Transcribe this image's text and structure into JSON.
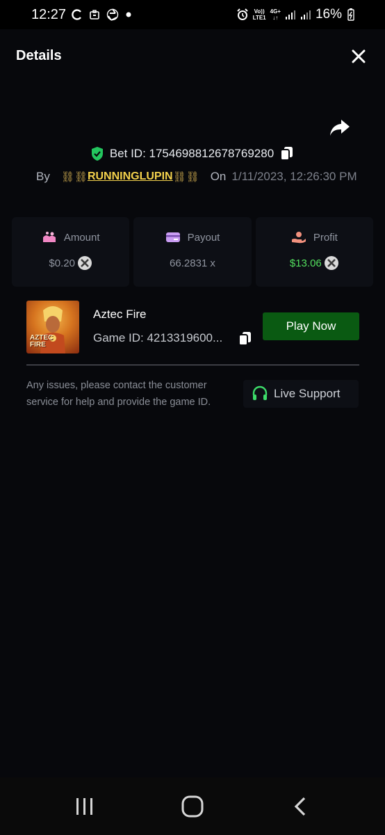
{
  "status_bar": {
    "time": "12:27",
    "battery": "16%",
    "network": "4G+",
    "volte": "Vo))",
    "lte": "LTE1"
  },
  "header": {
    "title": "Details"
  },
  "bet": {
    "id_text": "Bet ID: 1754698812678769280",
    "by_label": "By",
    "chain_left": "⛓⛓",
    "username": "RUNNINGLUPIN",
    "chain_right": "⛓⛓",
    "on_label": "On",
    "datetime": "1/11/2023, 12:26:30 PM"
  },
  "stats": {
    "amount": {
      "label": "Amount",
      "value": "$0.20"
    },
    "payout": {
      "label": "Payout",
      "value": "66.2831 x"
    },
    "profit": {
      "label": "Profit",
      "value": "$13.06"
    }
  },
  "game": {
    "name": "Aztec Fire",
    "id_text": "Game ID: 4213319600...",
    "thumb_line1": "AZTEC",
    "thumb_line2": "FIRE",
    "play_label": "Play Now"
  },
  "support": {
    "help_text": "Any issues, please contact the customer service for help and provide the game ID.",
    "button_label": "Live Support"
  },
  "colors": {
    "background": "#07080c",
    "accent_green": "#0a5a12",
    "profit_green": "#53e05e",
    "username_yellow": "#f4d24c"
  }
}
